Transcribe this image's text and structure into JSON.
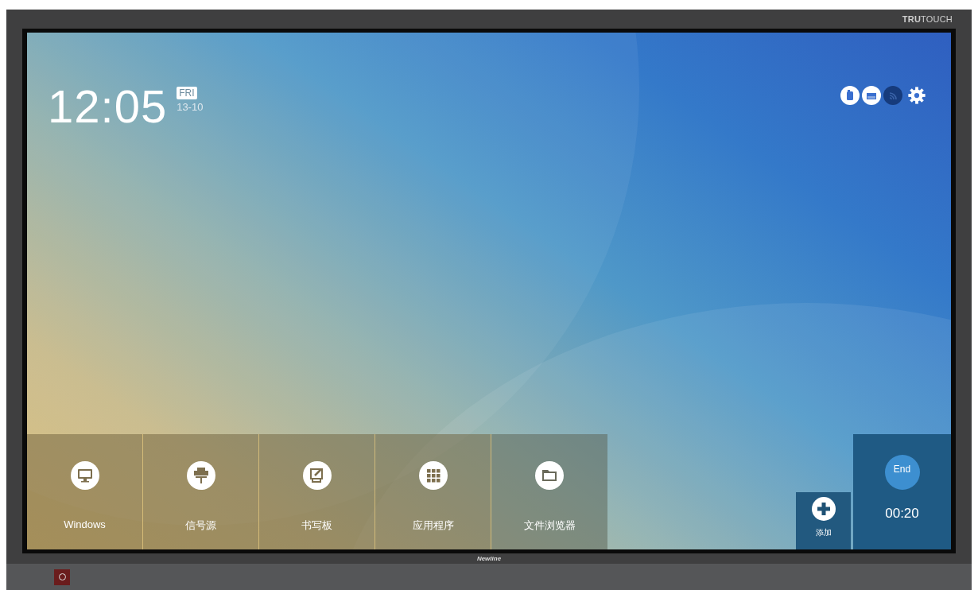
{
  "brand": "**TRU**TOUCH",
  "clock": {
    "time": "12:05",
    "weekday": "FRI",
    "date": "13-10"
  },
  "status_icons": [
    {
      "kind": "usb",
      "active": true
    },
    {
      "kind": "ethernet",
      "active": true
    },
    {
      "kind": "wifi",
      "active": false
    },
    {
      "kind": "settings",
      "active": true
    }
  ],
  "apps": [
    {
      "label": "Windows",
      "kind": "monitor"
    },
    {
      "label": "信号源",
      "kind": "source"
    },
    {
      "label": "书写板",
      "kind": "whiteboard"
    },
    {
      "label": "应用程序",
      "kind": "grid"
    },
    {
      "label": "文件浏览器",
      "kind": "folder"
    }
  ],
  "add": {
    "label": "添加"
  },
  "timer": {
    "button": "End",
    "elapsed": "00:20"
  },
  "bezel_logo": "Newline"
}
